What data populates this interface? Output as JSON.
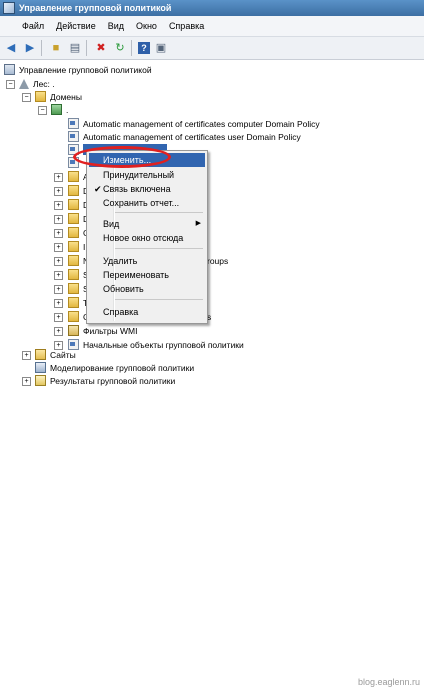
{
  "window": {
    "title": "Управление групповой политикой"
  },
  "menubar": {
    "items": [
      "Файл",
      "Действие",
      "Вид",
      "Окно",
      "Справка"
    ]
  },
  "toolbar": {
    "buttons": [
      "back-icon",
      "forward-icon",
      "up-folder-icon",
      "show-hide-tree-icon",
      "delete-icon",
      "refresh-icon",
      "help-icon",
      "properties-icon"
    ]
  },
  "tree": {
    "root": "Управление групповой политикой",
    "forest": "Лес: .",
    "domains": "Домены",
    "domain": ".",
    "gpo1": "Automatic management of certificates computer Domain Policy",
    "gpo2": "Automatic management of certificates user Domain Policy",
    "partial_roups": "roups",
    "partial_s": "s",
    "wmi": "Фильтры WMI",
    "starter": "Начальные объекты групповой политики",
    "sites": "Сайты",
    "modeling": "Моделирование групповой политики",
    "results": "Результаты групповой политики",
    "folder_letters": [
      "A",
      "D",
      "D",
      "D",
      "C",
      "I",
      "N",
      "S",
      "S",
      "T",
      "C"
    ]
  },
  "context_menu": {
    "items": {
      "edit": "Изменить...",
      "enforced": "Принудительный",
      "link_enabled": "Связь включена",
      "save_report": "Сохранить отчет...",
      "view": "Вид",
      "new_window": "Новое окно отсюда",
      "delete": "Удалить",
      "rename": "Переименовать",
      "refresh": "Обновить",
      "help": "Справка"
    }
  },
  "watermark": "blog.eaglenn.ru",
  "colors": {
    "title_bar": "#3c6fa3",
    "selection": "#3165b0",
    "highlight_ring": "#e02020"
  }
}
